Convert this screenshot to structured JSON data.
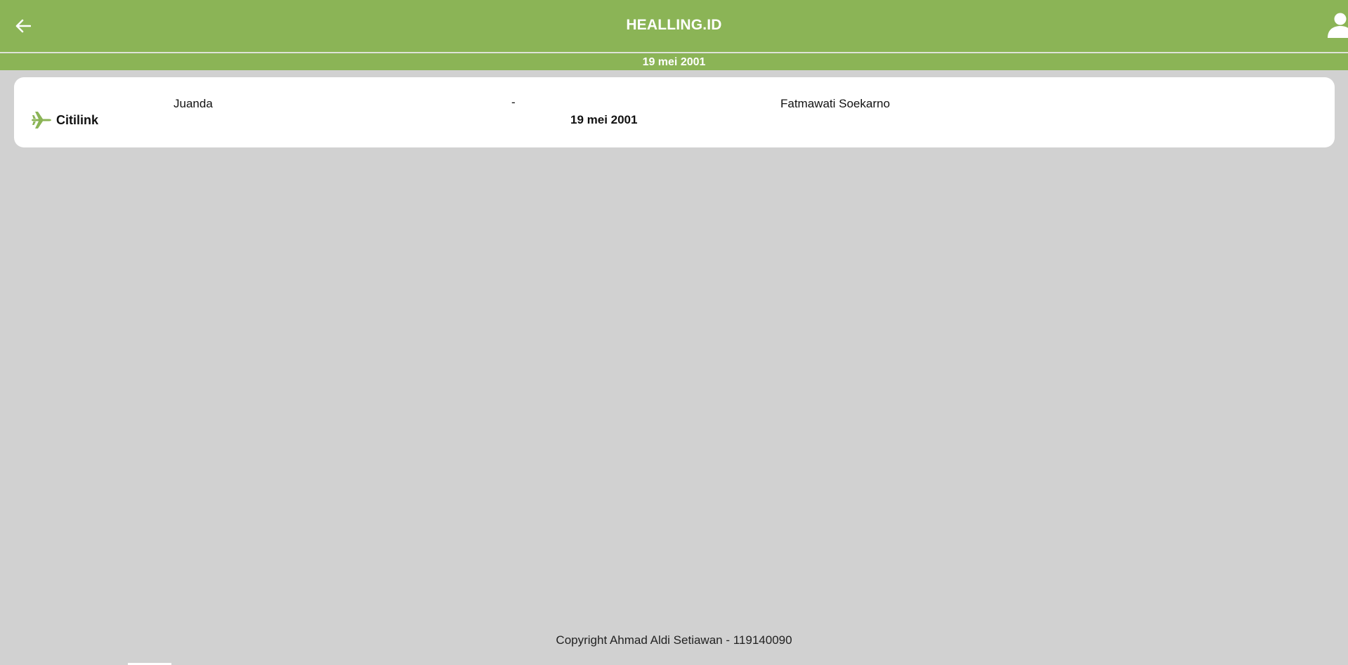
{
  "header": {
    "brand": "HEALLING.ID",
    "back_icon": "arrow-left-icon",
    "user_icon": "user-icon",
    "accent_color": "#8bb456"
  },
  "date_bar": {
    "date": "19 mei 2001"
  },
  "flight": {
    "airline_icon": "plane-icon",
    "airline": "Citilink",
    "origin": "Juanda",
    "separator": "-",
    "destination": "Fatmawati Soekarno",
    "date": "19 mei 2001"
  },
  "footer": {
    "copyright": "Copyright Ahmad Aldi Setiawan - 119140090"
  }
}
